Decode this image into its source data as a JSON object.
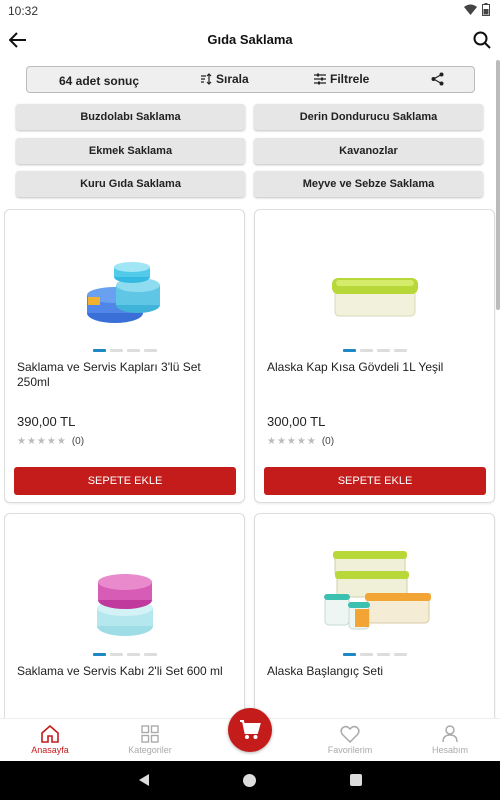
{
  "status": {
    "time": "10:32"
  },
  "header": {
    "title": "Gıda Saklama"
  },
  "toolbar": {
    "count": "64 adet sonuç",
    "sort_label": "Sırala",
    "filter_label": "Filtrele"
  },
  "categories": [
    "Buzdolabı Saklama",
    "Derin Dondurucu Saklama",
    "Ekmek Saklama",
    "Kavanozlar",
    "Kuru Gıda Saklama",
    "Meyve ve Sebze Saklama"
  ],
  "products": [
    {
      "name": "Saklama ve Servis Kapları 3'lü Set 250ml",
      "price": "390,00 TL",
      "stars": "★★★★★",
      "rating_count": "(0)",
      "button": "SEPETE EKLE"
    },
    {
      "name": "Alaska Kap Kısa Gövdeli 1L Yeşil",
      "price": "300,00 TL",
      "stars": "★★★★★",
      "rating_count": "(0)",
      "button": "SEPETE EKLE"
    },
    {
      "name": "Saklama ve Servis Kabı 2'li Set 600 ml",
      "price": "",
      "stars": "",
      "rating_count": "",
      "button": ""
    },
    {
      "name": "Alaska Başlangıç Seti",
      "price": "",
      "stars": "",
      "rating_count": "",
      "button": ""
    }
  ],
  "nav": {
    "home": "Anasayfa",
    "categories": "Kategoriler",
    "favorites": "Favorilerim",
    "account": "Hesabım"
  },
  "colors": {
    "accent": "#c41b1b",
    "dot_active": "#1e88c7"
  }
}
